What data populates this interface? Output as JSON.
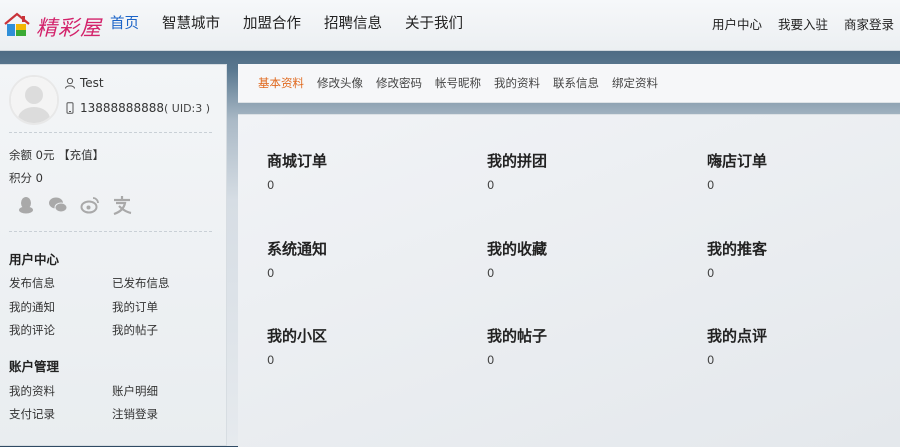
{
  "header": {
    "logo_text": "精彩屋",
    "nav": [
      "首页",
      "智慧城市",
      "加盟合作",
      "招聘信息",
      "关于我们"
    ],
    "top_links": [
      "用户中心",
      "我要入驻",
      "商家登录"
    ]
  },
  "user": {
    "name": "Test",
    "phone": "13888888888",
    "uid": "( UID:3 )",
    "balance": "余额 0元",
    "recharge": "【充值】",
    "points": "积分 0"
  },
  "sidebar": {
    "user_center_title": "用户中心",
    "user_center_links": [
      "发布信息",
      "已发布信息",
      "我的通知",
      "我的订单",
      "我的评论",
      "我的帖子"
    ],
    "account_title": "账户管理",
    "account_links": [
      "我的资料",
      "账户明细",
      "支付记录",
      "注销登录"
    ]
  },
  "tabs": [
    "基本资料",
    "修改头像",
    "修改密码",
    "帐号昵称",
    "我的资料",
    "联系信息",
    "绑定资料"
  ],
  "stats": [
    {
      "title": "商城订单",
      "value": "0"
    },
    {
      "title": "我的拼团",
      "value": "0"
    },
    {
      "title": "嗨店订单",
      "value": "0"
    },
    {
      "title": "系统通知",
      "value": "0"
    },
    {
      "title": "我的收藏",
      "value": "0"
    },
    {
      "title": "我的推客",
      "value": "0"
    },
    {
      "title": "我的小区",
      "value": "0"
    },
    {
      "title": "我的帖子",
      "value": "0"
    },
    {
      "title": "我的点评",
      "value": "0"
    }
  ],
  "colors": {
    "logo": "#d3236b",
    "nav_active": "#1b64c8",
    "tab_active": "#e0691e"
  }
}
